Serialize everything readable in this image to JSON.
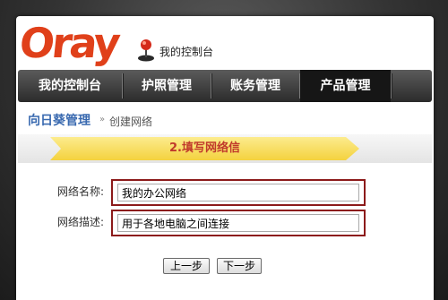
{
  "header": {
    "logo_text": "Oray",
    "console_title": "我的控制台"
  },
  "nav": {
    "items": [
      {
        "label": "我的控制台",
        "active": false
      },
      {
        "label": "护照管理",
        "active": false
      },
      {
        "label": "账务管理",
        "active": false
      },
      {
        "label": "产品管理",
        "active": true
      }
    ]
  },
  "breadcrumb": {
    "section": "向日葵管理",
    "separator": "»",
    "current": "创建网络"
  },
  "step": {
    "title": "2.填写网络信"
  },
  "form": {
    "name_label": "网络名称:",
    "name_value": "我的办公网络",
    "desc_label": "网络描述:",
    "desc_value": "用于各地电脑之间连接"
  },
  "buttons": {
    "prev": "上一步",
    "next": "下一步"
  },
  "colors": {
    "brand": "#e0401a",
    "link": "#3a6ab0",
    "step_arrow": "#f7dc5a",
    "highlight_border": "#8c1a1a"
  },
  "icons": {
    "mascot": "joystick-icon"
  }
}
